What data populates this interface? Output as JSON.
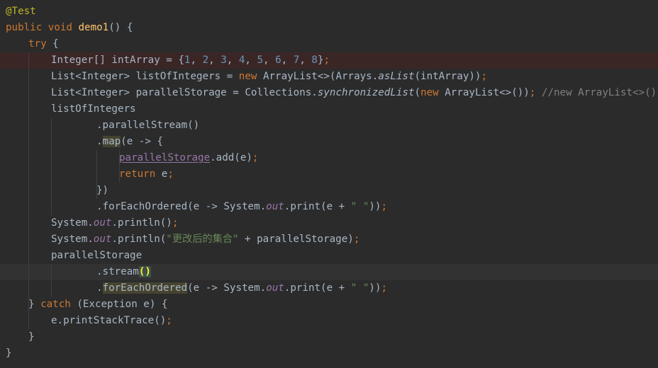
{
  "editor": {
    "lines": [
      [
        {
          "t": "@Test",
          "c": "annotation"
        }
      ],
      [
        {
          "t": "public ",
          "c": "keyword"
        },
        {
          "t": "void ",
          "c": "keyword"
        },
        {
          "t": "demo1",
          "c": "method-decl"
        },
        {
          "t": "() {"
        }
      ],
      [
        {
          "t": "try ",
          "c": "keyword"
        },
        {
          "t": "{"
        }
      ],
      [
        {
          "t": "Integer[] intArray = {"
        },
        {
          "t": "1",
          "c": "number"
        },
        {
          "t": ", "
        },
        {
          "t": "2",
          "c": "number"
        },
        {
          "t": ", "
        },
        {
          "t": "3",
          "c": "number"
        },
        {
          "t": ", "
        },
        {
          "t": "4",
          "c": "number"
        },
        {
          "t": ", "
        },
        {
          "t": "5",
          "c": "number"
        },
        {
          "t": ", "
        },
        {
          "t": "6",
          "c": "number"
        },
        {
          "t": ", "
        },
        {
          "t": "7",
          "c": "number"
        },
        {
          "t": ", "
        },
        {
          "t": "8",
          "c": "number"
        },
        {
          "t": "}"
        },
        {
          "t": ";",
          "c": "keyword"
        }
      ],
      [
        {
          "t": "List<Integer> listOfIntegers = "
        },
        {
          "t": "new ",
          "c": "keyword"
        },
        {
          "t": "ArrayList<>(Arrays."
        },
        {
          "t": "asList",
          "c": "static-method"
        },
        {
          "t": "(intArray))"
        },
        {
          "t": ";",
          "c": "keyword"
        }
      ],
      [
        {
          "t": "List<Integer> parallelStorage = Collections."
        },
        {
          "t": "synchronizedList",
          "c": "static-method"
        },
        {
          "t": "("
        },
        {
          "t": "new ",
          "c": "keyword"
        },
        {
          "t": "ArrayList<>())"
        },
        {
          "t": "; ",
          "c": "keyword"
        },
        {
          "t": "//new ArrayList<>();//",
          "c": "comment"
        }
      ],
      [
        {
          "t": "listOfIntegers"
        }
      ],
      [
        {
          "t": ".parallelStream()"
        }
      ],
      [
        {
          "t": "."
        },
        {
          "t": "map",
          "c": "warn-hl"
        },
        {
          "t": "(e -> {"
        }
      ],
      [
        {
          "t": "parallelStorage",
          "c": "underline-field"
        },
        {
          "t": ".add(e)"
        },
        {
          "t": ";",
          "c": "keyword"
        }
      ],
      [
        {
          "t": "return ",
          "c": "keyword"
        },
        {
          "t": "e"
        },
        {
          "t": ";",
          "c": "keyword"
        }
      ],
      [
        {
          "t": "})"
        }
      ],
      [
        {
          "t": ".forEachOrdered(e -> System."
        },
        {
          "t": "out",
          "c": "static-field"
        },
        {
          "t": ".print(e + "
        },
        {
          "t": "\" \"",
          "c": "string"
        },
        {
          "t": "))"
        },
        {
          "t": ";",
          "c": "keyword"
        }
      ],
      [
        {
          "t": "System."
        },
        {
          "t": "out",
          "c": "static-field"
        },
        {
          "t": ".println()"
        },
        {
          "t": ";",
          "c": "keyword"
        }
      ],
      [
        {
          "t": "System."
        },
        {
          "t": "out",
          "c": "static-field"
        },
        {
          "t": ".println("
        },
        {
          "t": "\"更改后的集合\"",
          "c": "string"
        },
        {
          "t": " + parallelStorage)"
        },
        {
          "t": ";",
          "c": "keyword"
        }
      ],
      [
        {
          "t": "parallelStorage"
        }
      ],
      [
        {
          "t": ".stream"
        },
        {
          "t": "()",
          "c": "brace-match"
        }
      ],
      [
        {
          "t": "."
        },
        {
          "t": "forEachOrdered",
          "c": "warn-hl"
        },
        {
          "t": "(e -> System."
        },
        {
          "t": "out",
          "c": "static-field"
        },
        {
          "t": ".print(e + "
        },
        {
          "t": "\" \"",
          "c": "string"
        },
        {
          "t": "))"
        },
        {
          "t": ";",
          "c": "keyword"
        }
      ],
      [
        {
          "t": "} "
        },
        {
          "t": "catch ",
          "c": "keyword"
        },
        {
          "t": "(Exception e) {"
        }
      ],
      [
        {
          "t": "e.printStackTrace()"
        },
        {
          "t": ";",
          "c": "keyword"
        }
      ],
      [
        {
          "t": "}"
        }
      ],
      [
        {
          "t": "}"
        }
      ]
    ]
  }
}
